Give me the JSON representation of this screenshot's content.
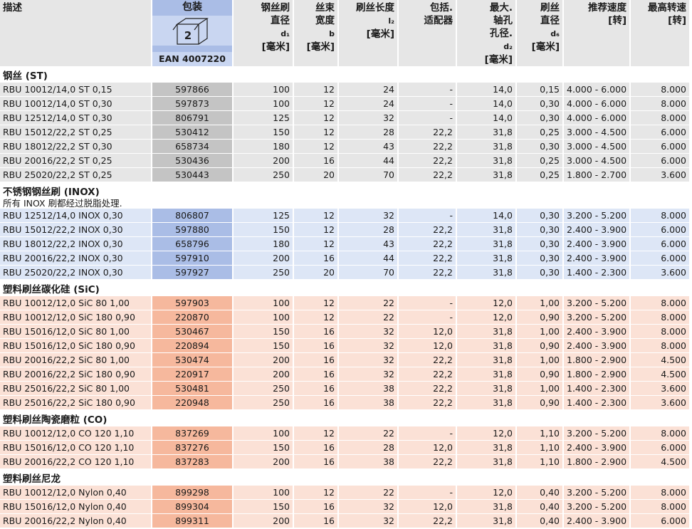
{
  "header": {
    "desc": "描述",
    "pkg_title": "包装",
    "pkg_qty": "2",
    "ean": "EAN 4007220",
    "c2": [
      "钢丝刷",
      "直径",
      "d₁",
      "[毫米]"
    ],
    "c3": [
      "丝束",
      "宽度",
      "b",
      "[毫米]"
    ],
    "c4": [
      "刷丝长度",
      "l₂",
      "[毫米]"
    ],
    "c5": [
      "包括.",
      "适配器"
    ],
    "c6": [
      "最大.",
      "轴孔",
      "孔径.",
      "d₂",
      "[毫米]"
    ],
    "c7": [
      "刷丝",
      "直径",
      "d₆",
      "[毫米]"
    ],
    "c8": [
      "推荐速度",
      "[转]"
    ],
    "c9": [
      "最高转速",
      "[转]"
    ]
  },
  "sections": [
    {
      "title": "钢丝 (ST)",
      "note": "",
      "theme": "g",
      "rows": [
        [
          "RBU 10012/14,0 ST 0,15",
          "597866",
          "100",
          "12",
          "24",
          "-",
          "14,0",
          "0,15",
          "4.000 - 6.000",
          "8.000"
        ],
        [
          "RBU 10012/14,0 ST 0,30",
          "597873",
          "100",
          "12",
          "24",
          "-",
          "14,0",
          "0,30",
          "4.000 - 6.000",
          "8.000"
        ],
        [
          "RBU 12512/14,0 ST 0,30",
          "806791",
          "125",
          "12",
          "32",
          "-",
          "14,0",
          "0,30",
          "4.000 - 6.000",
          "8.000"
        ],
        [
          "RBU 15012/22,2 ST 0,25",
          "530412",
          "150",
          "12",
          "28",
          "22,2",
          "31,8",
          "0,25",
          "3.000 - 4.500",
          "6.000"
        ],
        [
          "RBU 18012/22,2 ST 0,30",
          "658734",
          "180",
          "12",
          "43",
          "22,2",
          "31,8",
          "0,30",
          "3.000 - 4.500",
          "6.000"
        ],
        [
          "RBU 20016/22,2 ST 0,25",
          "530436",
          "200",
          "16",
          "44",
          "22,2",
          "31,8",
          "0,25",
          "3.000 - 4.500",
          "6.000"
        ],
        [
          "RBU 25020/22,2 ST 0,25",
          "530443",
          "250",
          "20",
          "70",
          "22,2",
          "31,8",
          "0,25",
          "1.800 - 2.700",
          "3.600"
        ]
      ]
    },
    {
      "title": "不锈钢钢丝刷 (INOX)",
      "note": "所有 INOX 刷都经过脱脂处理.",
      "theme": "b",
      "rows": [
        [
          "RBU 12512/14,0 INOX 0,30",
          "806807",
          "125",
          "12",
          "32",
          "-",
          "14,0",
          "0,30",
          "3.200 - 5.200",
          "8.000"
        ],
        [
          "RBU 15012/22,2 INOX 0,30",
          "597880",
          "150",
          "12",
          "28",
          "22,2",
          "31,8",
          "0,30",
          "2.400 - 3.900",
          "6.000"
        ],
        [
          "RBU 18012/22,2 INOX 0,30",
          "658796",
          "180",
          "12",
          "43",
          "22,2",
          "31,8",
          "0,30",
          "2.400 - 3.900",
          "6.000"
        ],
        [
          "RBU 20016/22,2 INOX 0,30",
          "597910",
          "200",
          "16",
          "44",
          "22,2",
          "31,8",
          "0,30",
          "2.400 - 3.900",
          "6.000"
        ],
        [
          "RBU 25020/22,2 INOX 0,30",
          "597927",
          "250",
          "20",
          "70",
          "22,2",
          "31,8",
          "0,30",
          "1.400 - 2.300",
          "3.600"
        ]
      ]
    },
    {
      "title": "塑料刷丝碳化硅 (SiC)",
      "note": "",
      "theme": "r",
      "rows": [
        [
          "RBU 10012/12,0 SiC 80 1,00",
          "597903",
          "100",
          "12",
          "22",
          "-",
          "12,0",
          "1,00",
          "3.200 - 5.200",
          "8.000"
        ],
        [
          "RBU 10012/12,0 SiC 180 0,90",
          "220870",
          "100",
          "12",
          "22",
          "-",
          "12,0",
          "0,90",
          "3.200 - 5.200",
          "8.000"
        ],
        [
          "RBU 15016/12,0 SiC 80 1,00",
          "530467",
          "150",
          "16",
          "32",
          "12,0",
          "31,8",
          "1,00",
          "2.400 - 3.900",
          "8.000"
        ],
        [
          "RBU 15016/12,0 SiC 180 0,90",
          "220894",
          "150",
          "16",
          "32",
          "12,0",
          "31,8",
          "0,90",
          "2.400 - 3.900",
          "8.000"
        ],
        [
          "RBU 20016/22,2 SiC 80 1,00",
          "530474",
          "200",
          "16",
          "32",
          "22,2",
          "31,8",
          "1,00",
          "1.800 - 2.900",
          "4.500"
        ],
        [
          "RBU 20016/22,2 SiC 180 0,90",
          "220917",
          "200",
          "16",
          "32",
          "22,2",
          "31,8",
          "0,90",
          "1.800 - 2.900",
          "4.500"
        ],
        [
          "RBU 25016/22,2 SiC 80 1,00",
          "530481",
          "250",
          "16",
          "38",
          "22,2",
          "31,8",
          "1,00",
          "1.400 - 2.300",
          "3.600"
        ],
        [
          "RBU 25016/22,2 SiC 180 0,90",
          "220948",
          "250",
          "16",
          "38",
          "22,2",
          "31,8",
          "0,90",
          "1.400 - 2.300",
          "3.600"
        ]
      ]
    },
    {
      "title": "塑料刷丝陶瓷磨粒 (CO)",
      "note": "",
      "theme": "r",
      "rows": [
        [
          "RBU 10012/12,0 CO 120 1,10",
          "837269",
          "100",
          "12",
          "22",
          "-",
          "12,0",
          "1,10",
          "3.200 - 5.200",
          "8.000"
        ],
        [
          "RBU 15016/12,0 CO 120 1,10",
          "837276",
          "150",
          "16",
          "28",
          "12,0",
          "31,8",
          "1,10",
          "2.400 - 3.900",
          "6.000"
        ],
        [
          "RBU 20016/22,2 CO 120 1,10",
          "837283",
          "200",
          "16",
          "38",
          "22,2",
          "31,8",
          "1,10",
          "1.800 - 2.900",
          "4.500"
        ]
      ]
    },
    {
      "title": "塑料刷丝尼龙",
      "note": "",
      "theme": "r",
      "rows": [
        [
          "RBU 10012/12,0 Nylon 0,40",
          "899298",
          "100",
          "12",
          "22",
          "-",
          "12,0",
          "0,40",
          "3.200 - 5.200",
          "8.000"
        ],
        [
          "RBU 15016/12,0 Nylon 0,40",
          "899304",
          "150",
          "16",
          "32",
          "12,0",
          "31,8",
          "0,40",
          "3.200 - 5.200",
          "8.000"
        ],
        [
          "RBU 20016/22,2 Nylon 0,40",
          "899311",
          "200",
          "16",
          "32",
          "22,2",
          "31,8",
          "0,40",
          "2.400 - 3.900",
          "6.000"
        ]
      ]
    }
  ]
}
